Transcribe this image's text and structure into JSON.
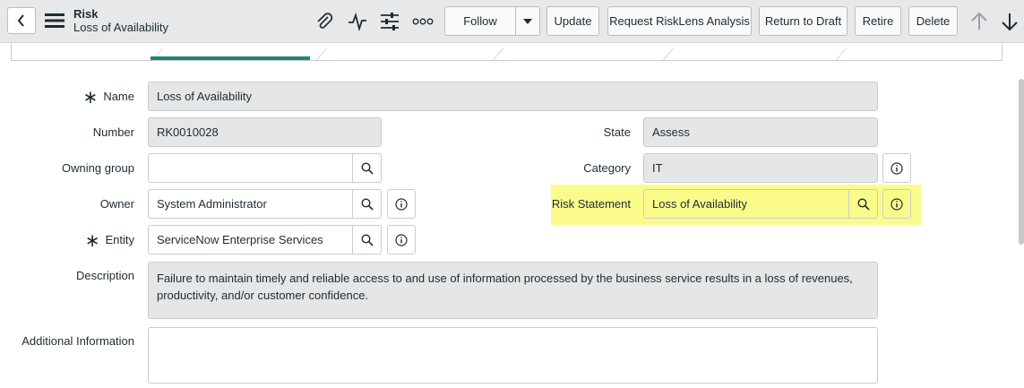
{
  "header": {
    "table_name": "Risk",
    "record_name": "Loss of Availability",
    "buttons": {
      "follow": "Follow",
      "update": "Update",
      "request_risklens": "Request RiskLens Analysis",
      "return_to_draft": "Return to Draft",
      "retire": "Retire",
      "delete": "Delete"
    },
    "icons": [
      "back-icon",
      "menu-icon",
      "paperclip-icon",
      "activity-icon",
      "sliders-icon",
      "more-icon",
      "chevron-down-icon",
      "arrow-up-icon",
      "arrow-down-icon"
    ]
  },
  "form": {
    "name": {
      "label": "Name",
      "value": "Loss of Availability"
    },
    "number": {
      "label": "Number",
      "value": "RK0010028"
    },
    "state": {
      "label": "State",
      "value": "Assess"
    },
    "owning_group": {
      "label": "Owning group",
      "value": ""
    },
    "category": {
      "label": "Category",
      "value": "IT"
    },
    "owner": {
      "label": "Owner",
      "value": "System Administrator"
    },
    "risk_statement": {
      "label": "Risk Statement",
      "value": "Loss of Availability"
    },
    "entity": {
      "label": "Entity",
      "value": "ServiceNow Enterprise Services"
    },
    "description": {
      "label": "Description",
      "value": "Failure to maintain timely and reliable access to and use of information processed by the business service results in a loss of revenues, productivity, and/or customer confidence."
    },
    "additional_info": {
      "label": "Additional Information",
      "value": ""
    },
    "required_marker": "∗"
  },
  "colors": {
    "highlight": "#fbfb8c",
    "active_tab": "#1f8476",
    "header_bg": "#e6e8ea"
  }
}
